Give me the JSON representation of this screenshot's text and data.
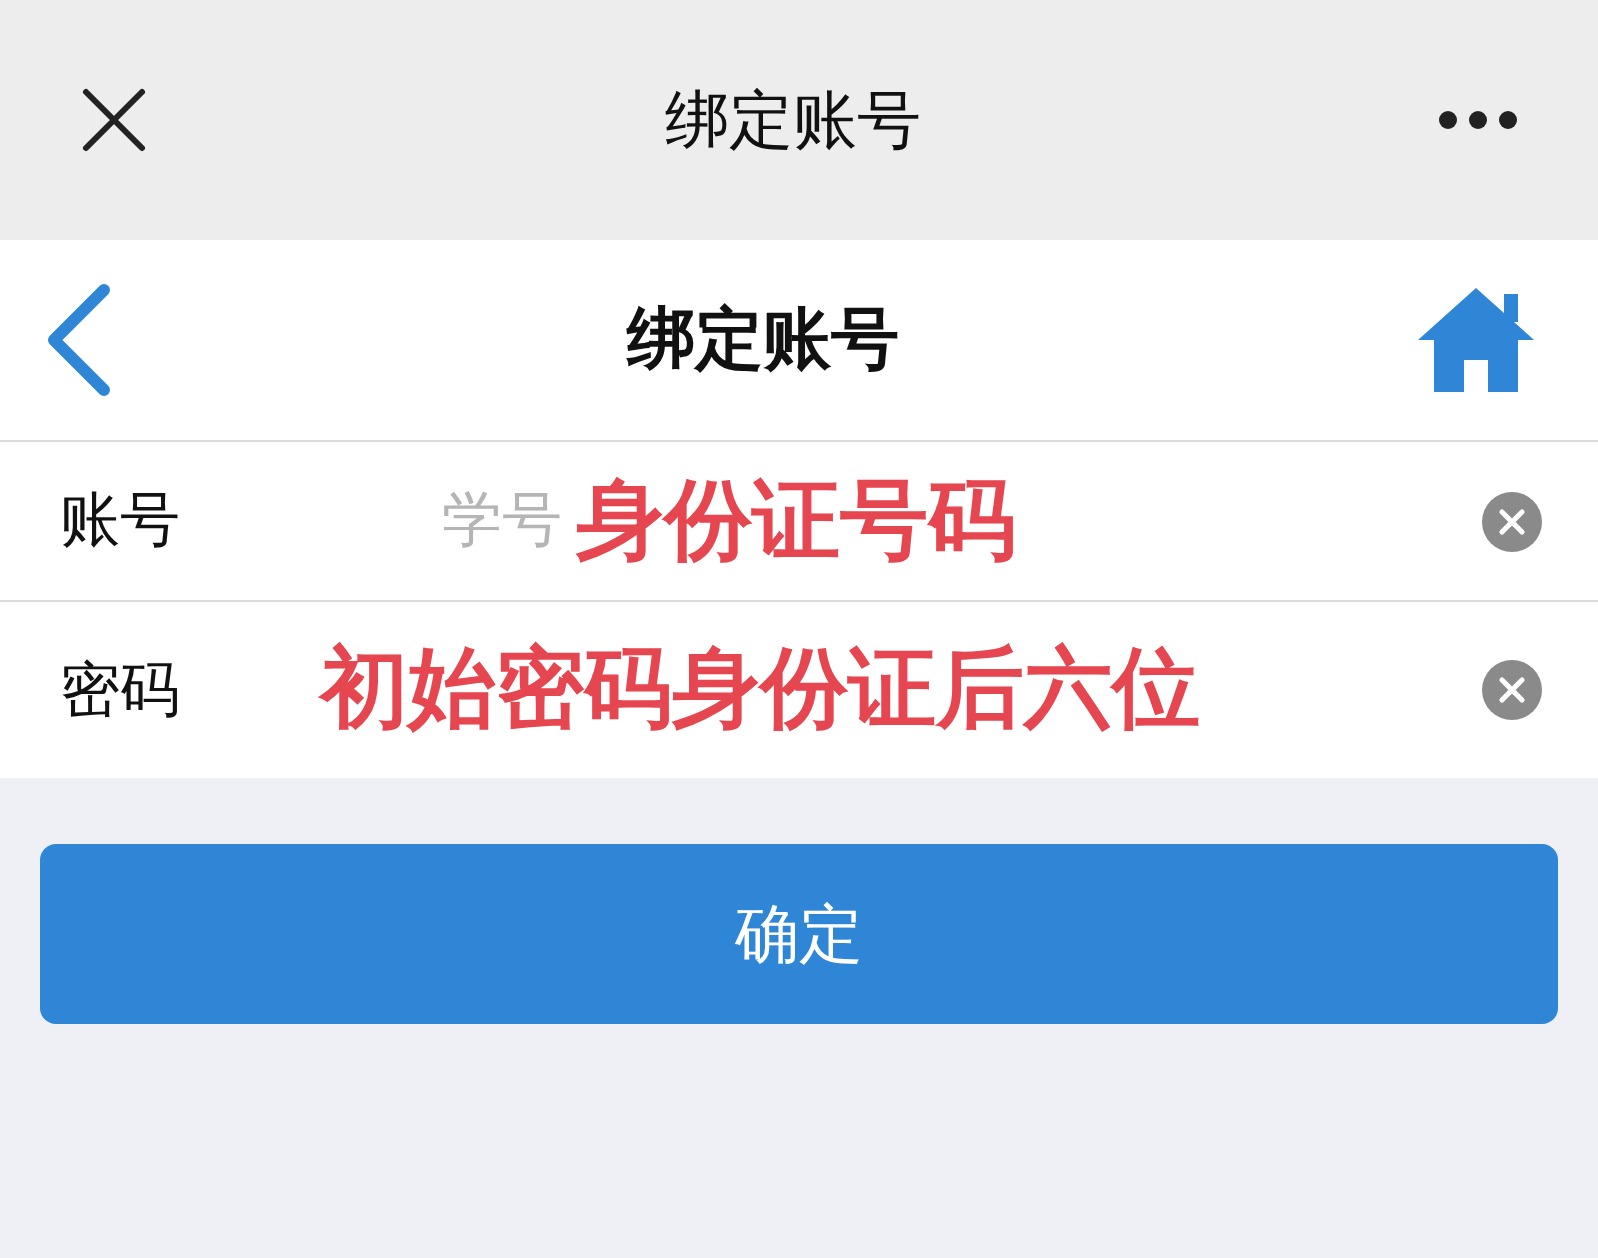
{
  "top_bar": {
    "title": "绑定账号"
  },
  "nav_bar": {
    "title": "绑定账号"
  },
  "fields": [
    {
      "label": "账号",
      "placeholder": "学号",
      "annotation": "身份证号码"
    },
    {
      "label": "密码",
      "annotation": "初始密码身份证后六位"
    }
  ],
  "submit_button": "确定"
}
